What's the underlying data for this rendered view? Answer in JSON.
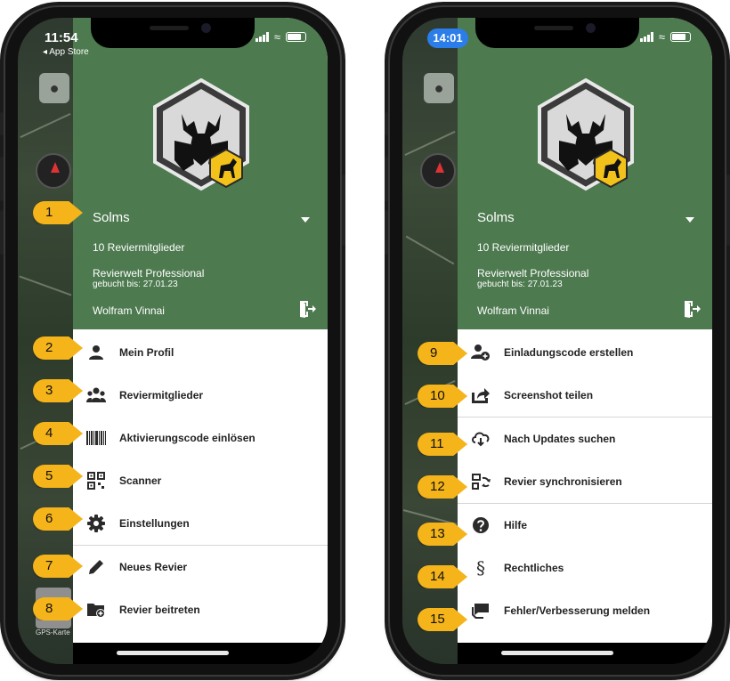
{
  "left_phone": {
    "status": {
      "time": "11:54",
      "back_label": "◂ App Store"
    },
    "map": {
      "gps_label": "GPS-Karte"
    },
    "header": {
      "revier": "Solms",
      "members": "10 Reviermitglieder",
      "plan": "Revierwelt Professional",
      "booked": "gebucht bis: 27.01.23",
      "user": "Wolfram Vinnai"
    },
    "items": [
      {
        "label": "Mein Profil",
        "icon": "person-icon",
        "callout": "2"
      },
      {
        "label": "Reviermitglieder",
        "icon": "group-icon",
        "callout": "3"
      },
      {
        "label": "Aktivierungscode einlösen",
        "icon": "barcode-icon",
        "callout": "4"
      },
      {
        "label": "Scanner",
        "icon": "qr-code-icon",
        "callout": "5"
      },
      {
        "label": "Einstellungen",
        "icon": "gear-icon",
        "callout": "6"
      },
      {
        "label": "Neues Revier",
        "icon": "pencil-icon",
        "callout": "7"
      },
      {
        "label": "Revier beitreten",
        "icon": "folder-add-icon",
        "callout": "8"
      }
    ],
    "header_callout": "1"
  },
  "right_phone": {
    "status": {
      "time": "14:01"
    },
    "header": {
      "revier": "Solms",
      "members": "10 Reviermitglieder",
      "plan": "Revierwelt Professional",
      "booked": "gebucht bis: 27.01.23",
      "user": "Wolfram Vinnai"
    },
    "items": [
      {
        "label": "Einladungscode erstellen",
        "icon": "person-add-icon",
        "callout": "9"
      },
      {
        "label": "Screenshot teilen",
        "icon": "share-icon",
        "callout": "10"
      },
      {
        "label": "Nach Updates suchen",
        "icon": "cloud-download-icon",
        "callout": "11"
      },
      {
        "label": "Revier synchronisieren",
        "icon": "sync-icon",
        "callout": "12"
      },
      {
        "label": "Hilfe",
        "icon": "help-icon",
        "callout": "13"
      },
      {
        "label": "Rechtliches",
        "icon": "paragraph-icon",
        "callout": "14"
      },
      {
        "label": "Fehler/Verbesserung melden",
        "icon": "feedback-icon",
        "callout": "15"
      }
    ]
  },
  "colors": {
    "header_green": "#4d7a4f",
    "callout": "#f4b41a",
    "status_pill": "#2b7de9"
  }
}
